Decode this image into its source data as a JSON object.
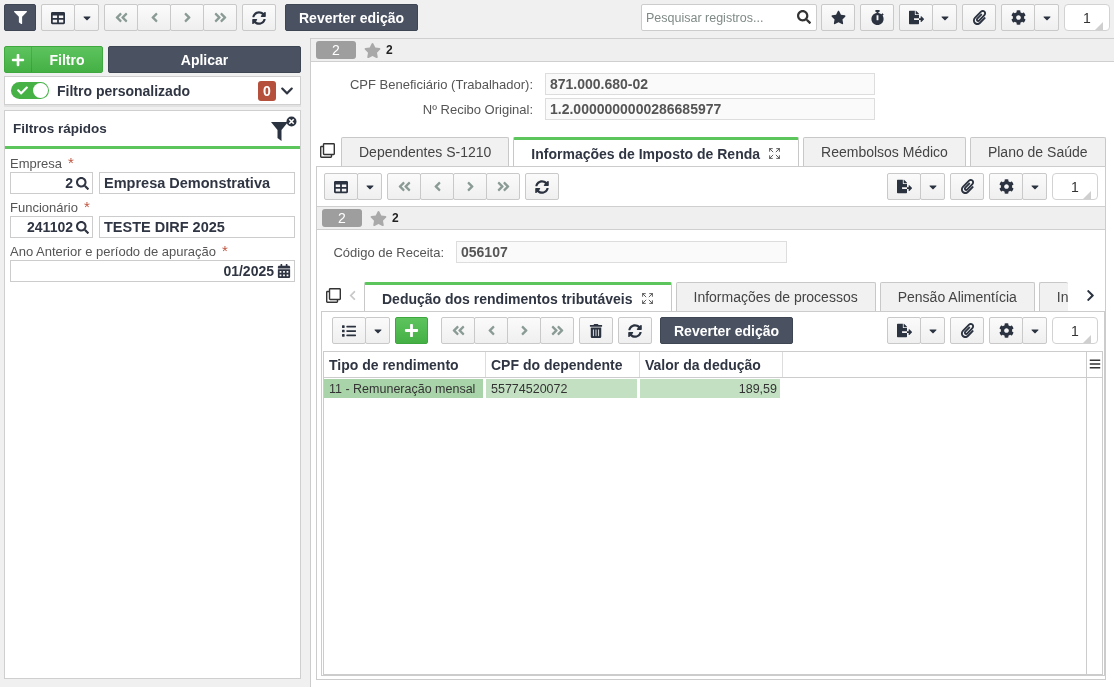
{
  "toolbar": {
    "revert_button": "Reverter edição",
    "search": {
      "placeholder": "Pesquisar registros..."
    },
    "page": "1"
  },
  "filter_panel": {
    "add_button": "Filtro",
    "apply_button": "Aplicar",
    "custom_filter": {
      "label": "Filtro personalizado",
      "on": true,
      "count": "0"
    },
    "quick_filters": {
      "title": "Filtros rápidos",
      "fields": [
        {
          "kind": "lookup",
          "label": "Empresa",
          "required_mark": "*",
          "code": "2",
          "description": "Empresa Demonstrativa"
        },
        {
          "kind": "lookup",
          "label": "Funcionário",
          "required_mark": "*",
          "code": "241102",
          "description": "TESTE DIRF 2025"
        },
        {
          "kind": "month",
          "label": "Ano Anterior e período de apuração",
          "required_mark": "*",
          "value": "01/2025"
        }
      ]
    }
  },
  "record": {
    "header": {
      "number": "2",
      "star_count": "2"
    },
    "fields": [
      {
        "label": "CPF Beneficiário (Trabalhador):",
        "value": "871.000.680-02"
      },
      {
        "label": "Nº Recibo Original:",
        "value": "1.2.0000000000286685977"
      }
    ],
    "tabs": [
      {
        "label": "Dependentes S-1210",
        "selected": false
      },
      {
        "label": "Informações de Imposto de Renda",
        "selected": true
      },
      {
        "label": "Reembolsos Médico",
        "selected": false
      },
      {
        "label": "Plano de Saúde",
        "selected": false
      }
    ],
    "tab_panel": {
      "page": "1",
      "header": {
        "number": "2",
        "star_count": "2"
      },
      "fields": [
        {
          "label": "Código de Receita:",
          "value": "056107"
        }
      ],
      "sub_tabs": [
        {
          "label": "Dedução dos rendimentos tributáveis",
          "selected": true
        },
        {
          "label": "Informações de processos",
          "selected": false
        },
        {
          "label": "Pensão Alimentícia",
          "selected": false
        },
        {
          "label": "In",
          "selected": false
        }
      ],
      "tab_scroll": {
        "left_disabled": true,
        "right_disabled": false
      },
      "sub_panel": {
        "revert_button": "Reverter edição",
        "page": "1",
        "table": {
          "columns": [
            {
              "label": "Tipo de rendimento",
              "kind": "text"
            },
            {
              "label": "CPF do dependente",
              "kind": "text"
            },
            {
              "label": "Valor da dedução",
              "kind": "number"
            }
          ],
          "rows": [
            {
              "cells": [
                "11 - Remuneração mensal",
                "55774520072",
                "189,59"
              ],
              "selected": true
            }
          ]
        }
      }
    }
  }
}
